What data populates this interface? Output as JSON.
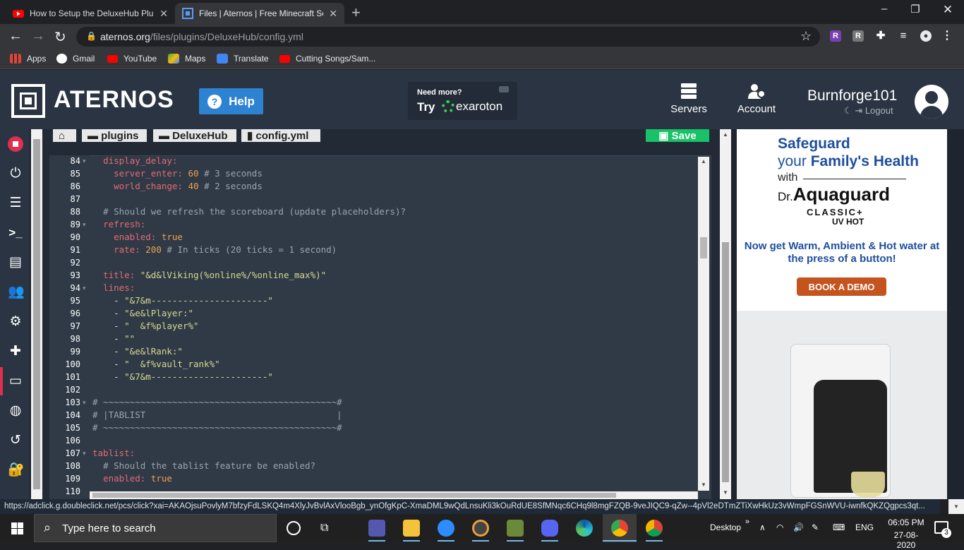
{
  "browser": {
    "tabs": [
      {
        "title": "How to Setup the DeluxeHub Plu",
        "icon": "youtube-icon"
      },
      {
        "title": "Files | Aternos | Free Minecraft Se",
        "icon": "aternos-icon"
      }
    ],
    "url_domain": "aternos.org",
    "url_path": "/files/plugins/DeluxeHub/config.yml",
    "bookmarks": [
      "Apps",
      "Gmail",
      "YouTube",
      "Maps",
      "Translate",
      "Cutting Songs/Sam..."
    ]
  },
  "header": {
    "brand": "ATERNOS",
    "help_label": "Help",
    "promo_line1": "Need more?",
    "promo_try": "Try",
    "promo_brand": "exaroton",
    "nav": [
      "Servers",
      "Account"
    ],
    "username": "Burnforge101",
    "logout": "Logout"
  },
  "breadcrumbs": [
    "plugins",
    "DeluxeHub",
    "config.yml"
  ],
  "save_label": "Save",
  "editor": {
    "lines": [
      {
        "n": "84",
        "fold": true
      },
      {
        "n": "85"
      },
      {
        "n": "86"
      },
      {
        "n": "87"
      },
      {
        "n": "88"
      },
      {
        "n": "89",
        "fold": true
      },
      {
        "n": "90"
      },
      {
        "n": "91"
      },
      {
        "n": "92"
      },
      {
        "n": "93"
      },
      {
        "n": "94",
        "fold": true
      },
      {
        "n": "95"
      },
      {
        "n": "96"
      },
      {
        "n": "97"
      },
      {
        "n": "98"
      },
      {
        "n": "99"
      },
      {
        "n": "100"
      },
      {
        "n": "101"
      },
      {
        "n": "102"
      },
      {
        "n": "103",
        "fold": true
      },
      {
        "n": "104"
      },
      {
        "n": "105"
      },
      {
        "n": "106"
      },
      {
        "n": "107",
        "fold": true
      },
      {
        "n": "108"
      },
      {
        "n": "109"
      },
      {
        "n": "110"
      }
    ],
    "code": {
      "l84": "display_delay:",
      "l85_key": "server_enter:",
      "l85_val": "60",
      "l85_cmt": "# 3 seconds",
      "l86_key": "world_change:",
      "l86_val": "40",
      "l86_cmt": "# 2 seconds",
      "l88": "# Should we refresh the scoreboard (update placeholders)?",
      "l89": "refresh:",
      "l90_key": "enabled:",
      "l90_val": "true",
      "l91_key": "rate:",
      "l91_val": "200",
      "l91_cmt": "# In ticks (20 ticks = 1 second)",
      "l93_key": "title:",
      "l93_val": "\"&d&lViking(%online%/%online_max%)\"",
      "l94": "lines:",
      "l95": "\"&7&m----------------------\"",
      "l96": "\"&e&lPlayer:\"",
      "l97": "\"  &f%player%\"",
      "l98": "\"\"",
      "l99": "\"&e&lRank:\"",
      "l100": "\"  &f%vault_rank%\"",
      "l101": "\"&7&m----------------------\"",
      "l103": "# ~~~~~~~~~~~~~~~~~~~~~~~~~~~~~~~~~~~~~~~~~~~~#",
      "l104": "# |TABLIST                                    |",
      "l105": "# ~~~~~~~~~~~~~~~~~~~~~~~~~~~~~~~~~~~~~~~~~~~~#",
      "l107": "tablist:",
      "l108": "# Should the tablist feature be enabled?",
      "l109_key": "enabled:",
      "l109_val": "true"
    }
  },
  "ad": {
    "h1": "Safeguard",
    "h2_a": "your",
    "h2_b": "Family's Health",
    "with": "with",
    "brand_prefix": "Dr.",
    "brand": "Aquaguard",
    "model": "CLASSIC+",
    "model2": "UV HOT",
    "tagline": "Now get Warm, Ambient & Hot water at the press of a button!",
    "cta": "BOOK A DEMO"
  },
  "status_url": "https://adclick.g.doubleclick.net/pcs/click?xai=AKAOjsuPovlyM7bfzyFdLSKQ4m4XlyJvBvlAxVlooBgb_ynOfgKpC-XmaDML9wQdLnsuKli3kOuRdUE8SfMNqc6CHq9l8mgFZQB-9veJIQC9-qZw--4pVl2eDTmZTiXwHkUz3vWmpFGSnWVU-iwnfkQKZQgpcs3qt...",
  "taskbar": {
    "search_placeholder": "Type here to search",
    "desktop_label": "Desktop",
    "lang": "ENG",
    "time": "06:05 PM",
    "date": "27-08-2020",
    "notification_count": "3"
  },
  "colors": {
    "accent_red": "#e02f4f",
    "help_blue": "#2d82d2",
    "save_green": "#19c268",
    "header_bg": "#2a3442"
  }
}
